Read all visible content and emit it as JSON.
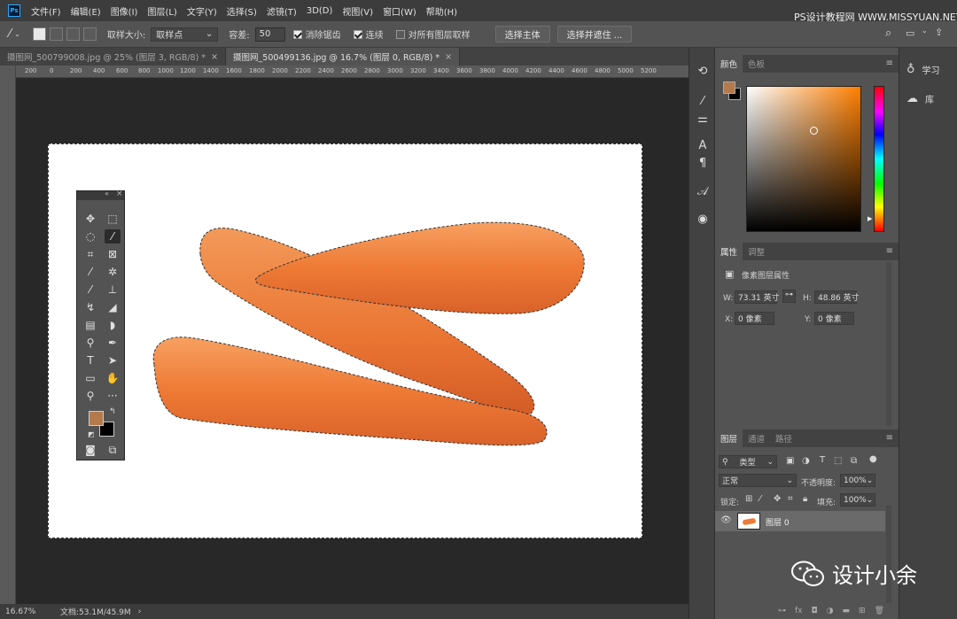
{
  "menu": {
    "logo": "Ps",
    "items": [
      "文件(F)",
      "编辑(E)",
      "图像(I)",
      "图层(L)",
      "文字(Y)",
      "选择(S)",
      "滤镜(T)",
      "3D(D)",
      "视图(V)",
      "窗口(W)",
      "帮助(H)"
    ],
    "watermark": "PS设计教程网 WWW.MISSYUAN.NET"
  },
  "options": {
    "sample_size_label": "取样大小:",
    "sample_size_value": "取样点",
    "tolerance_label": "容差:",
    "tolerance_value": "50",
    "anti_alias": "消除锯齿",
    "contiguous": "连续",
    "sample_all": "对所有图层取样",
    "select_subject": "选择主体",
    "select_mask": "选择并遮住 ..."
  },
  "tabs": [
    {
      "label": "摄图网_500799008.jpg @ 25% (图层 3, RGB/8) *",
      "close": "×"
    },
    {
      "label": "摄图网_500499136.jpg @ 16.7% (图层 0, RGB/8) *",
      "close": "×"
    }
  ],
  "ruler": [
    "200",
    "0",
    "200",
    "400",
    "600",
    "800",
    "1000",
    "1200",
    "1400",
    "1600",
    "1800",
    "2000",
    "2200",
    "2400",
    "2600",
    "2800",
    "3000",
    "3200",
    "3400",
    "3600",
    "3800",
    "4000",
    "4200",
    "4400",
    "4600",
    "4800",
    "5000",
    "5200"
  ],
  "status": {
    "zoom": "16.67%",
    "doc": "文档:53.1M/45.9M"
  },
  "color_panel": {
    "tabs": [
      "颜色",
      "色板"
    ],
    "fg": "#b47a4c",
    "bg": "#000000"
  },
  "properties": {
    "tabs": [
      "属性",
      "调整"
    ],
    "title": "像素图层属性",
    "w_label": "W:",
    "w_value": "73.31 英寸",
    "h_label": "H:",
    "h_value": "48.86 英寸",
    "x_label": "X:",
    "x_value": "0 像素",
    "y_label": "Y:",
    "y_value": "0 像素"
  },
  "layers": {
    "tabs": [
      "图层",
      "通道",
      "路径"
    ],
    "filter": "类型",
    "blend": "正常",
    "opacity_label": "不透明度:",
    "opacity": "100%",
    "lock_label": "锁定:",
    "fill_label": "填充:",
    "fill": "100%",
    "layer_name": "图层 0"
  },
  "far_right": {
    "learn": "学习",
    "libraries": "库"
  },
  "brand": "设计小余"
}
